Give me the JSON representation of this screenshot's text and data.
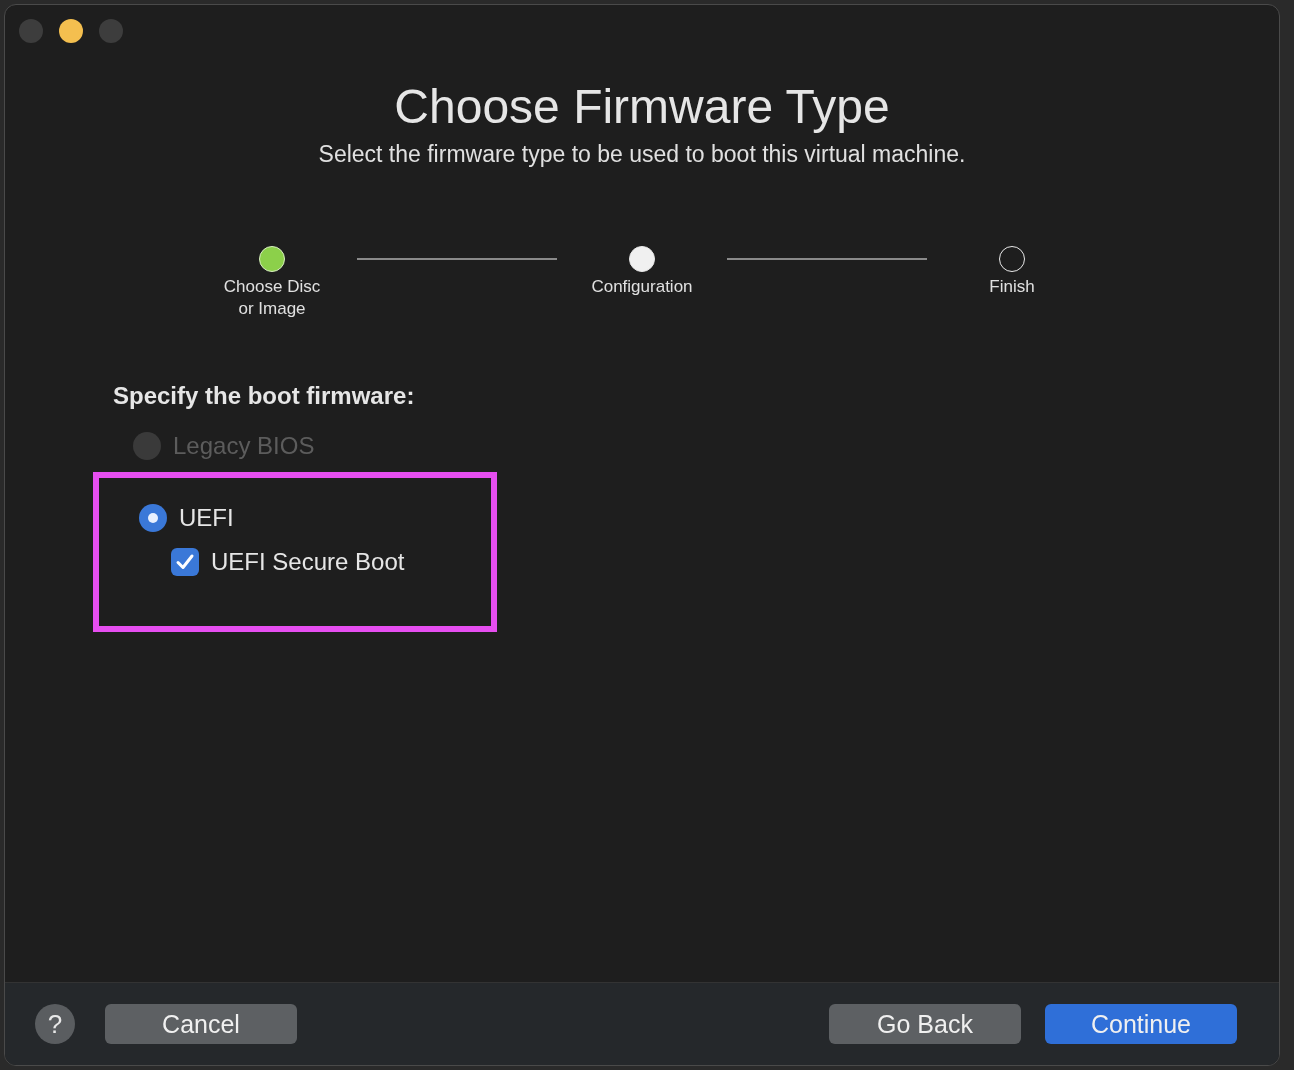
{
  "window": {
    "controls": [
      {
        "active": false
      },
      {
        "active": true
      },
      {
        "active": false
      }
    ]
  },
  "header": {
    "title": "Choose Firmware Type",
    "subtitle": "Select the firmware type to be used to boot this virtual machine."
  },
  "steps": [
    {
      "label": "Choose Disc\nor Image",
      "completed": true,
      "selected": false
    },
    {
      "label": "Configuration",
      "completed": false,
      "selected": true
    },
    {
      "label": "Finish",
      "completed": false,
      "selected": false
    }
  ],
  "firmware": {
    "label": "Specify the boot firmware:",
    "options": [
      {
        "kind": "radio",
        "label": "Legacy BIOS",
        "selected": false,
        "disabled": true,
        "highlighted": false
      },
      {
        "kind": "radio",
        "label": "UEFI",
        "selected": true,
        "disabled": false,
        "highlighted": true,
        "children": [
          {
            "kind": "checkbox",
            "label": "UEFI Secure Boot",
            "checked": true
          }
        ]
      }
    ]
  },
  "footer": {
    "help": "?",
    "cancel": "Cancel",
    "back": "Go Back",
    "continue": "Continue"
  }
}
